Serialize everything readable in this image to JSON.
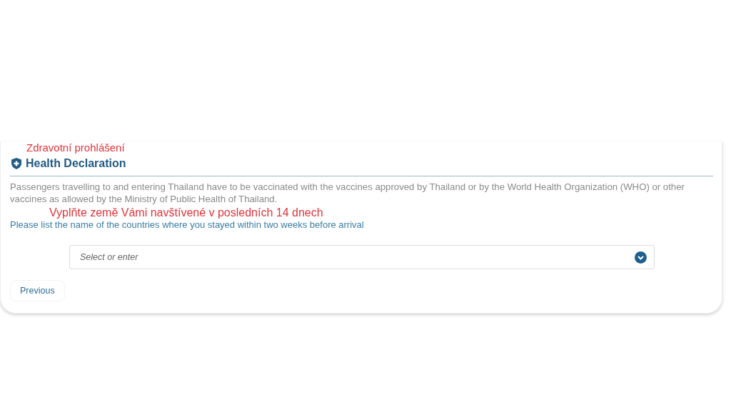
{
  "annotations": [
    {
      "text": "Zdravotní prohlášení"
    },
    {
      "text": "Vyplňte země Vámi navštívené v posledních 14 dnech"
    }
  ],
  "section": {
    "title": "Health Declaration"
  },
  "notice": "Passengers travelling to and entering Thailand have to be vaccinated with the vaccines approved by Thailand or by the World Health Organization (WHO) or other vaccines as allowed by the Ministry of Public Health of Thailand.",
  "countries": {
    "label": "Please list the name of the countries where you stayed within two weeks before arrival",
    "placeholder": "Select or enter"
  },
  "buttons": [
    {
      "label": "Previous"
    }
  ]
}
